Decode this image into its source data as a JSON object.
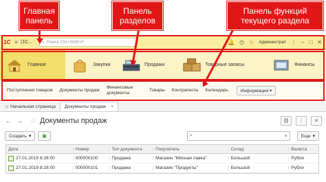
{
  "callouts": {
    "main_panel": "Главная панель",
    "sections_panel": "Панель разделов",
    "functions_panel": "Панель функций текущего раздела"
  },
  "main_panel": {
    "logo": "1С",
    "app_title": "(1С...",
    "search_placeholder": "Поиск Ctrl+Shift+F",
    "user": "Администрат"
  },
  "sections": [
    {
      "label": "Главное",
      "icon": "house-icon"
    },
    {
      "label": "Закупки",
      "icon": "shopping-bag-icon"
    },
    {
      "label": "Продажи",
      "icon": "cash-register-icon"
    },
    {
      "label": "Товарные запасы",
      "icon": "boxes-icon"
    },
    {
      "label": "Финансы",
      "icon": "finance-icon"
    }
  ],
  "functions": {
    "items": [
      "Поступления товаров",
      "Документы продаж",
      "Финансовые документы",
      "Товары",
      "Контрагенты",
      "Календарь"
    ],
    "info_button": "Информация"
  },
  "tabs": {
    "home": "Начальная страница",
    "active": "Документы продаж"
  },
  "form": {
    "title": "Документы продаж",
    "create_button": "Создать",
    "more_button": "Еще"
  },
  "table": {
    "columns": [
      "Дата",
      "Номер",
      "Тип документа",
      "Покупатель",
      "Склад",
      "Валюта"
    ],
    "rows": [
      {
        "date": "27.01.2019 8:28:00",
        "number": "000000100",
        "type": "Продажа",
        "buyer": "Магазин \"Мясная лавка\"",
        "store": "Большой",
        "currency": "Рубли"
      },
      {
        "date": "27.01.2019 8:28:00",
        "number": "000000101",
        "type": "Продажа",
        "buyer": "Магазин \"Продукты\"",
        "store": "Большой",
        "currency": "Рубли"
      }
    ]
  },
  "colors": {
    "accent_red": "#e11616",
    "panel_yellow": "#fbed9e",
    "section_active": "#f2de6a"
  }
}
